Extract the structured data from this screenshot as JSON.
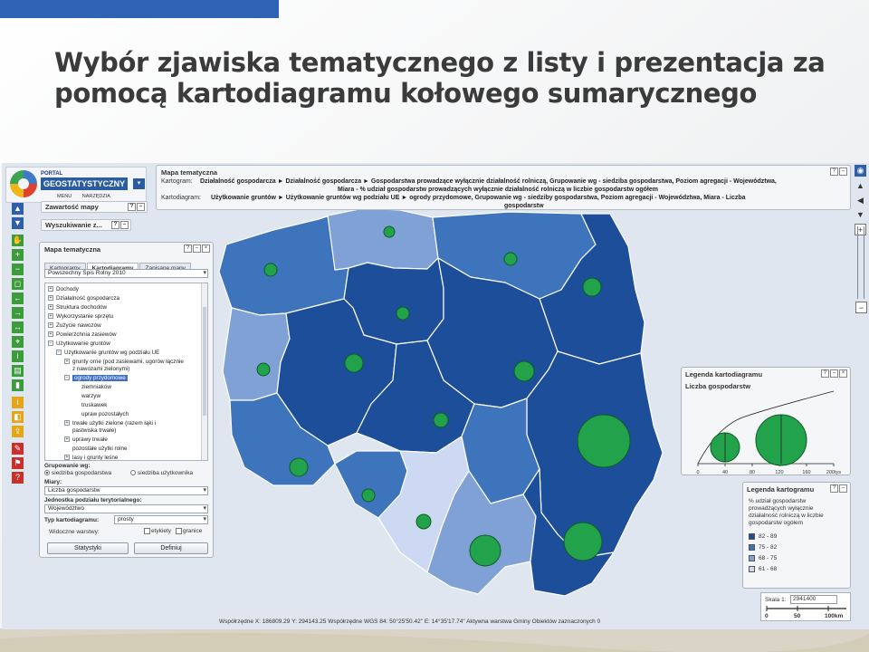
{
  "slide": {
    "title_line1": "Wybór zjawiska tematycznego z listy i prezentacja za",
    "title_line2": "pomocą kartodiagramu kołowego sumarycznego"
  },
  "logo": {
    "line1": "PORTAL",
    "line2": "GEOSTATYSTYCZNY",
    "menu": "MENU",
    "tools": "NARZĘDZIA"
  },
  "bars": {
    "contents": "Zawartość mapy",
    "search": "Wyszukiwanie z..."
  },
  "thematic_panel": {
    "title": "Mapa tematyczna",
    "cartogram_label": "Kartogram:",
    "cartogram_value_l1": "Działalność gospodarcza ► Działalność gospodarcza ► Gospodarstwa prowadzące wyłącznie działalność rolniczą, Grupowanie wg - siedziba gospodarstwa, Poziom agregacji - Województwa,",
    "cartogram_value_l2": "Miara - % udział gospodarstw prowadzących wyłącznie działalność rolniczą w liczbie gospodarstw ogółem",
    "diagram_label": "Kartodiagram:",
    "diagram_value_l1": "Użytkowanie gruntów ► Użytkowanie gruntów wg podziału UE ► ogrody przydomowe, Grupowanie wg - siedziby gospodarstwa, Poziom agregacji - Województwa, Miara - Liczba",
    "diagram_value_l2": "gospodarstw"
  },
  "left_panel": {
    "title": "Mapa tematyczna",
    "tabs": [
      "Kartogramy",
      "Kartodiagramy",
      "Zapisane mapy"
    ],
    "census": "Powszechny Spis Rolny 2010",
    "tree": [
      "Dochody",
      "Działalność gospodarcza",
      "Struktura dochodów",
      "Wykorzystanie sprzętu",
      "Zużycie nawozów",
      "Powierzchnia zasiewów",
      "Użytkowanie gruntów",
      "Użytkowanie gruntów wg podziału UE",
      "grunty orne (pod zasiewami, ugorów łącznie",
      "z nawozami zielonymi)",
      "ogrody przydomowe",
      "ziemniaków",
      "warzyw",
      "truskawek",
      "upraw pozostałych",
      "trwałe użytki zielone (razem łąki i",
      "pastwiska trwałe)",
      "uprawy trwałe",
      "pozostałe użytki rolne",
      "lasy i grunty leśne"
    ],
    "grouping_label": "Grupowanie wg:",
    "grouping_opt1": "siedziba gospodarstwa",
    "grouping_opt2": "siedziba użytkownika",
    "measures_label": "Miary:",
    "measure_value": "Liczba gospodarstw",
    "unit_label": "Jednostka podziału terytorialnego:",
    "unit_value": "Województwo",
    "type_label": "Typ kartodiagramu:",
    "type_value": "prosty",
    "layers_label": "Widoczne warstwy:",
    "layer1": "etykiety",
    "layer2": "granice",
    "btn_stats": "Statystyki",
    "btn_define": "Definiuj"
  },
  "legend_diagram": {
    "title": "Legenda kartodiagramu",
    "subtitle": "Liczba gospodarstw",
    "ticks": [
      "0",
      "40",
      "80",
      "120",
      "160",
      "200tys"
    ]
  },
  "legend_cartogram": {
    "title": "Legenda kartogramu",
    "desc_l1": "% udział gospodarstw",
    "desc_l2": "prowadzących wyłącznie",
    "desc_l3": "działalność rolniczą w liczbie",
    "desc_l4": "gospodarstw ogółem",
    "classes": [
      {
        "label": "82 - 89",
        "color": "#1d4e9a"
      },
      {
        "label": "75 - 82",
        "color": "#3d74bb"
      },
      {
        "label": "68 - 75",
        "color": "#7fa1d6"
      },
      {
        "label": "61 - 68",
        "color": "#cdd9f2"
      }
    ]
  },
  "scale": {
    "label": "Skala 1:",
    "value": "2941400",
    "ticks": [
      "0",
      "50",
      "100km"
    ]
  },
  "status": {
    "text": "Współrzędne X: 186809.29 Y: 294143.25   Współrzędne WGS 84: 50°25'50.42\" E: 14°35'17.74\"   Aktywna warstwa Gminy   Obiektów zaznaczonych 0"
  },
  "icons": {
    "left_toolbar": [
      "nav-up-icon",
      "nav-down-icon",
      "pan-icon",
      "zoom-in-icon",
      "zoom-out-icon",
      "zoom-box-icon",
      "back-icon",
      "forward-icon",
      "measure-icon",
      "select-icon",
      "identify-icon",
      "print-icon",
      "chart-icon",
      "info-icon",
      "layer-icon",
      "export-icon",
      "tool-icon",
      "flag-icon",
      "help-icon"
    ]
  }
}
